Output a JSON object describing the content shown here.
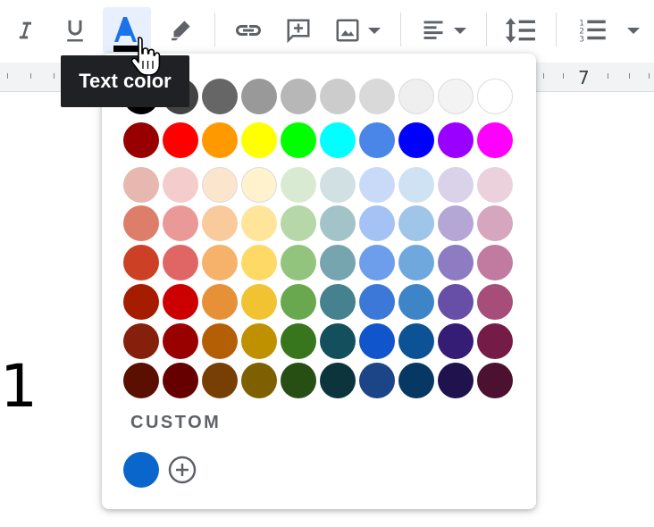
{
  "toolbar": {
    "italic": "italic-icon",
    "underline": "underline-icon",
    "text_color": "text-color-icon",
    "highlight": "highlight-icon",
    "link": "link-icon",
    "comment": "add-comment-icon",
    "image": "insert-image-icon",
    "align": "align-icon",
    "line_spacing": "line-spacing-icon",
    "numbered_list": "numbered-list-icon",
    "accent": "#1a73e8"
  },
  "tooltip": {
    "text": "Text color"
  },
  "ruler": {
    "number": "7"
  },
  "doc": {
    "text": "1"
  },
  "palette": {
    "rows": [
      [
        "#000000",
        "#434343",
        "#666666",
        "#999999",
        "#b7b7b7",
        "#cccccc",
        "#d9d9d9",
        "#efefef",
        "#f3f3f3",
        "#ffffff"
      ],
      [
        "#980000",
        "#ff0000",
        "#ff9900",
        "#ffff00",
        "#00ff00",
        "#00ffff",
        "#4a86e8",
        "#0000ff",
        "#9900ff",
        "#ff00ff"
      ],
      [
        "#e6b8af",
        "#f4cccc",
        "#fce5cd",
        "#fff2cc",
        "#d9ead3",
        "#d0e0e3",
        "#c9daf8",
        "#cfe2f3",
        "#d9d2e9",
        "#ead1dc"
      ],
      [
        "#dd7e6b",
        "#ea9999",
        "#f9cb9c",
        "#ffe599",
        "#b6d7a8",
        "#a2c4c9",
        "#a4c2f4",
        "#9fc5e8",
        "#b4a7d6",
        "#d5a6bd"
      ],
      [
        "#cc4125",
        "#e06666",
        "#f6b26b",
        "#ffd966",
        "#93c47d",
        "#76a5af",
        "#6d9eeb",
        "#6fa8dc",
        "#8e7cc3",
        "#c27ba0"
      ],
      [
        "#a61c00",
        "#cc0000",
        "#e69138",
        "#f1c232",
        "#6aa84f",
        "#45818e",
        "#3c78d8",
        "#3d85c6",
        "#674ea7",
        "#a64d79"
      ],
      [
        "#85200c",
        "#990000",
        "#b45f06",
        "#bf9000",
        "#38761d",
        "#134f5c",
        "#1155cc",
        "#0b5394",
        "#351c75",
        "#741b47"
      ],
      [
        "#5b0f00",
        "#660000",
        "#783f04",
        "#7f6000",
        "#274e13",
        "#0c343d",
        "#1c4587",
        "#073763",
        "#20124d",
        "#4c1130"
      ]
    ],
    "custom_label": "CUSTOM",
    "custom_color": "#0b66cc",
    "add_custom_icon": "add-circle-icon"
  }
}
